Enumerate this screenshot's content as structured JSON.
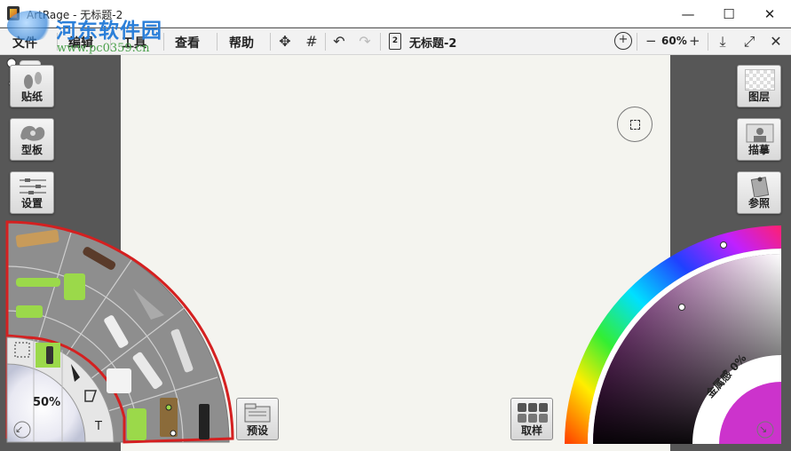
{
  "window": {
    "title": "ArtRage - 无标题-2",
    "minimize_label": "—",
    "maximize_label": "☐",
    "close_label": "✕"
  },
  "watermark": {
    "site_name": "河东软件园",
    "url": "www.pc0359.cn"
  },
  "menubar": {
    "items": [
      {
        "label": "文件"
      },
      {
        "label": "编辑"
      },
      {
        "label": "工具"
      },
      {
        "label": "查看"
      },
      {
        "label": "帮助"
      }
    ],
    "document_number": "2",
    "document_title": "无标题-2",
    "zoom_minus": "−",
    "zoom_value": "60%",
    "zoom_plus": "+"
  },
  "left_panel": {
    "stickers_label": "贴纸",
    "stencils_label": "型板",
    "settings_label": "设置"
  },
  "right_panel": {
    "layers_label": "图层",
    "tracing_label": "描摹",
    "reference_label": "参照"
  },
  "tool_wheel": {
    "brush_size_value": "50%",
    "text_tool_label": "T"
  },
  "bottom": {
    "presets_label": "预设",
    "samples_label": "取样"
  },
  "color_picker": {
    "metallic_label": "金属感 0%",
    "accent_color": "#cc33cc"
  },
  "colors": {
    "selection_outline": "#d42020",
    "canvas_background": "#f4f4ef",
    "tool_accent": "#9bd94a"
  }
}
